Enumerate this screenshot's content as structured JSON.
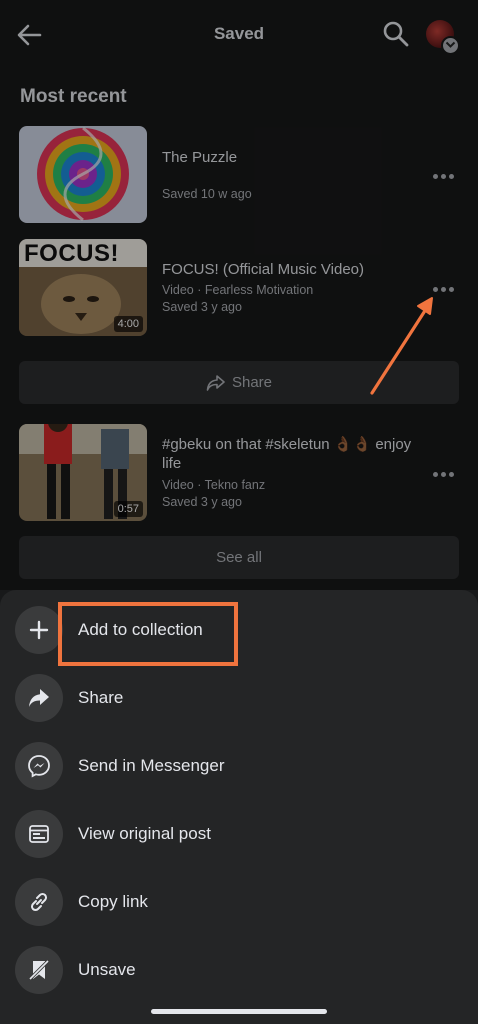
{
  "header": {
    "title": "Saved",
    "back_icon": "back-arrow-icon",
    "search_icon": "search-icon"
  },
  "section": {
    "title": "Most recent"
  },
  "items": [
    {
      "title": "The Puzzle",
      "meta1": "Saved 10 w ago",
      "meta2": "",
      "duration": ""
    },
    {
      "title": "FOCUS! (Official Music Video)",
      "meta1": "Video · Fearless Motivation",
      "meta2": "Saved 3 y ago",
      "duration": "4:00",
      "thumb_text": "FOCUS!"
    },
    {
      "title": "#gbeku on that #skeletun 👌🏾👌🏾 enjoy life",
      "meta1": "Video · Tekno fanz",
      "meta2": "Saved 3 y ago",
      "duration": "0:57"
    }
  ],
  "share_bar": {
    "label": "Share"
  },
  "see_all": {
    "label": "See all"
  },
  "sheet": {
    "items": [
      {
        "label": "Add to collection",
        "icon": "plus-icon"
      },
      {
        "label": "Share",
        "icon": "share-arrow-icon"
      },
      {
        "label": "Send in Messenger",
        "icon": "messenger-icon"
      },
      {
        "label": "View original post",
        "icon": "post-icon"
      },
      {
        "label": "Copy link",
        "icon": "link-icon"
      },
      {
        "label": "Unsave",
        "icon": "unsave-icon"
      }
    ]
  },
  "colors": {
    "background": "#18191a",
    "sheet": "#242526",
    "annotation": "#f0743e"
  }
}
